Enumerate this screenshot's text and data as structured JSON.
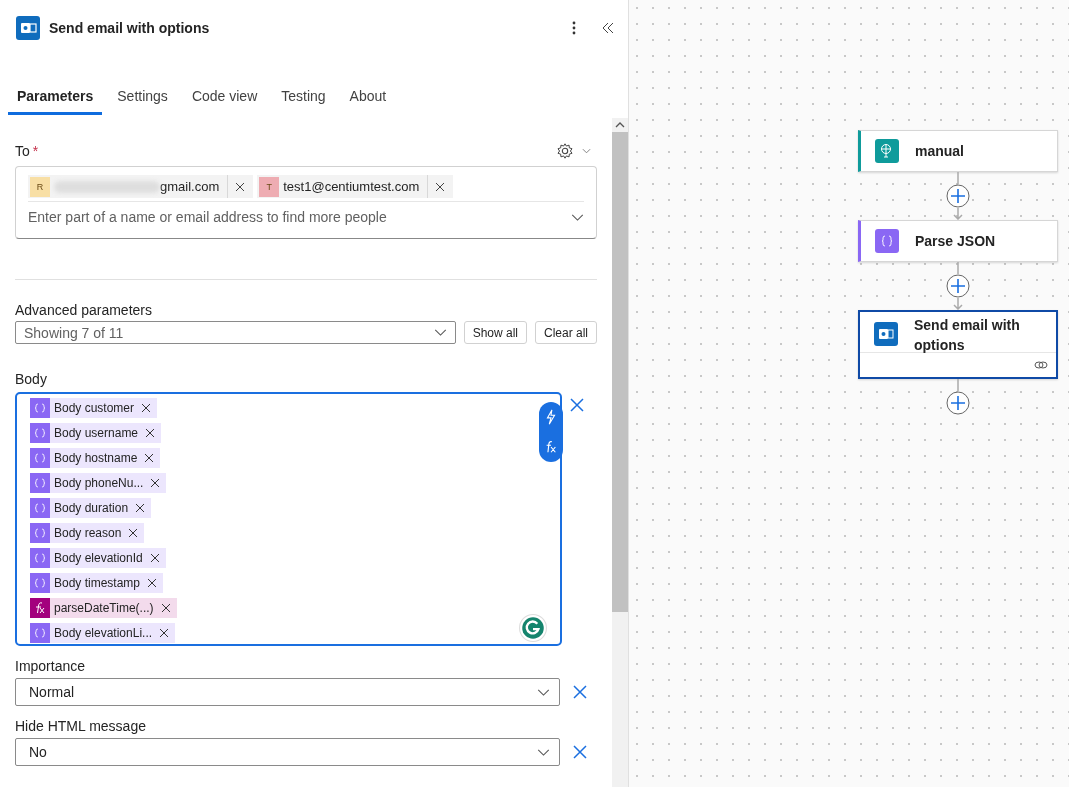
{
  "panel": {
    "title": "Send email with options",
    "tabs": [
      {
        "label": "Parameters",
        "selected": true
      },
      {
        "label": "Settings",
        "selected": false
      },
      {
        "label": "Code view",
        "selected": false
      },
      {
        "label": "Testing",
        "selected": false
      },
      {
        "label": "About",
        "selected": false
      }
    ],
    "to": {
      "label": "To",
      "required_mark": "*",
      "recipients": [
        {
          "initial": "R",
          "visible_text": "gmail.com",
          "redacted": true,
          "color": "#f8dfa5"
        },
        {
          "initial": "T",
          "visible_text": "test1@centiumtest.com",
          "redacted": false,
          "color": "#eeacb2"
        }
      ],
      "placeholder": "Enter part of a name or email address to find more people"
    },
    "advanced": {
      "label": "Advanced parameters",
      "value": "Showing 7 of 11",
      "buttons": [
        "Show all",
        "Clear all"
      ]
    },
    "body": {
      "label": "Body",
      "tokens": [
        {
          "kind": "variable",
          "text": "Body customer"
        },
        {
          "kind": "variable",
          "text": "Body username"
        },
        {
          "kind": "variable",
          "text": "Body hostname"
        },
        {
          "kind": "variable",
          "text": "Body phoneNu..."
        },
        {
          "kind": "variable",
          "text": "Body duration"
        },
        {
          "kind": "variable",
          "text": "Body reason"
        },
        {
          "kind": "variable",
          "text": "Body elevationId"
        },
        {
          "kind": "variable",
          "text": "Body timestamp"
        },
        {
          "kind": "expression",
          "text": "parseDateTime(...)"
        },
        {
          "kind": "variable",
          "text": "Body elevationLi..."
        }
      ]
    },
    "selects": [
      {
        "label": "Importance",
        "value": "Normal"
      },
      {
        "label": "Hide HTML message",
        "value": "No"
      }
    ]
  },
  "flow": {
    "nodes": [
      {
        "kind": "trigger",
        "title": "manual",
        "color": "#0f9b9b",
        "selected": false
      },
      {
        "kind": "variable",
        "title": "Parse JSON",
        "color": "#8a67f4",
        "selected": false
      },
      {
        "kind": "outlook",
        "title": "Send email with options",
        "color": "#0f6cbd",
        "selected": true
      }
    ]
  }
}
